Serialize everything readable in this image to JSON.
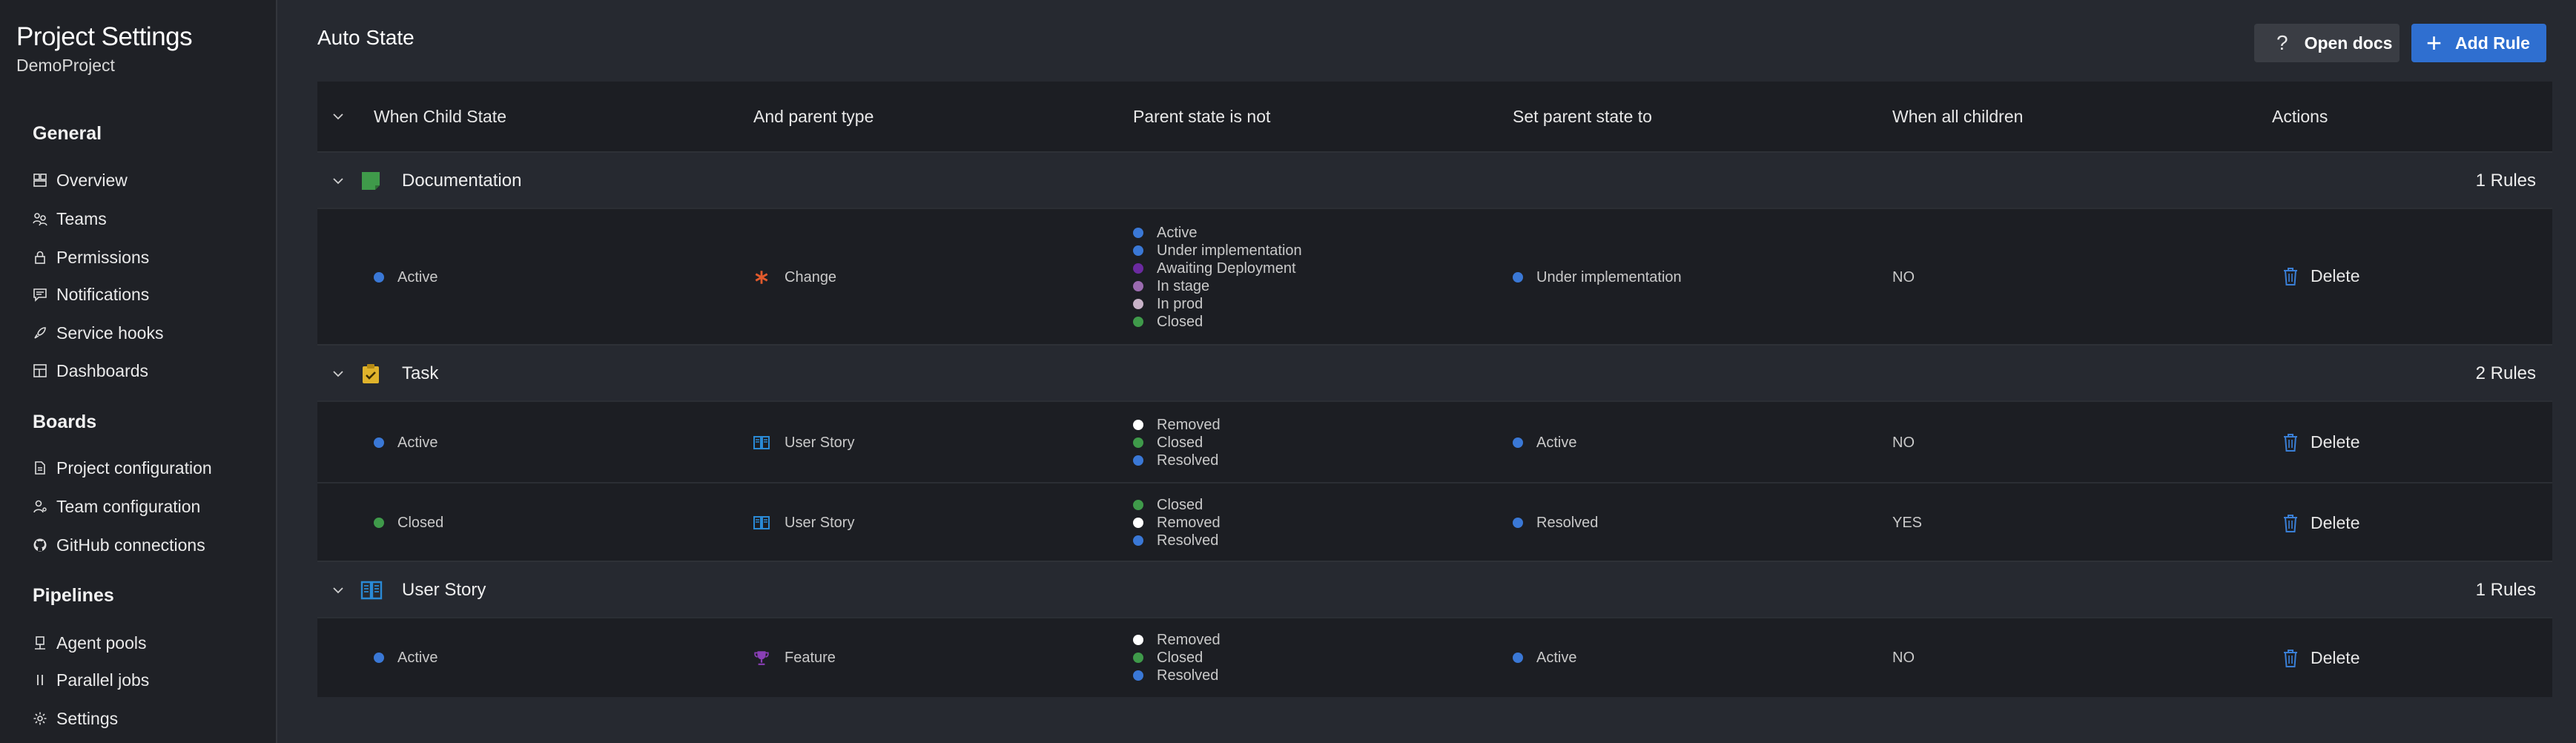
{
  "sidebar": {
    "title": "Project Settings",
    "project": "DemoProject",
    "sections": [
      {
        "label": "General",
        "items": [
          {
            "label": "Overview",
            "icon": "overview-icon"
          },
          {
            "label": "Teams",
            "icon": "teams-icon"
          },
          {
            "label": "Permissions",
            "icon": "lock-icon"
          },
          {
            "label": "Notifications",
            "icon": "chat-icon"
          },
          {
            "label": "Service hooks",
            "icon": "rocket-icon"
          },
          {
            "label": "Dashboards",
            "icon": "dashboard-icon"
          }
        ]
      },
      {
        "label": "Boards",
        "items": [
          {
            "label": "Project configuration",
            "icon": "doc-icon"
          },
          {
            "label": "Team configuration",
            "icon": "team-config-icon"
          },
          {
            "label": "GitHub connections",
            "icon": "github-icon"
          }
        ]
      },
      {
        "label": "Pipelines",
        "items": [
          {
            "label": "Agent pools",
            "icon": "agent-icon"
          },
          {
            "label": "Parallel jobs",
            "icon": "parallel-icon"
          },
          {
            "label": "Settings",
            "icon": "gear-icon"
          }
        ]
      }
    ]
  },
  "main": {
    "title": "Auto State",
    "open_docs": "Open docs",
    "add_rule": "Add Rule"
  },
  "table": {
    "headers": [
      "When Child State",
      "And parent type",
      "Parent state is not",
      "Set parent state to",
      "When all children",
      "Actions"
    ],
    "groups": [
      {
        "name": "Documentation",
        "count": "1 Rules",
        "icon": "documentation-icon",
        "icon_color": "#3f9a4a",
        "rules": [
          {
            "child_state": "Active",
            "child_color": "#3a78d6",
            "parent_type": "Change",
            "parent_icon": "asterisk-icon",
            "parent_icon_color": "#e25a2c",
            "not_states": [
              {
                "label": "Active",
                "color": "#3a78d6"
              },
              {
                "label": "Under implementation",
                "color": "#3a78d6"
              },
              {
                "label": "Awaiting Deployment",
                "color": "#6b2aa0"
              },
              {
                "label": "In stage",
                "color": "#9b6bb0"
              },
              {
                "label": "In prod",
                "color": "#c8b3c8"
              },
              {
                "label": "Closed",
                "color": "#3f9a4a"
              }
            ],
            "set_state": "Under implementation",
            "set_color": "#3a78d6",
            "all_children": "NO",
            "action": "Delete"
          }
        ]
      },
      {
        "name": "Task",
        "count": "2 Rules",
        "icon": "task-icon",
        "icon_color": "#e0b32b",
        "rules": [
          {
            "child_state": "Active",
            "child_color": "#3a78d6",
            "parent_type": "User Story",
            "parent_icon": "book-icon",
            "parent_icon_color": "#2a8ad6",
            "not_states": [
              {
                "label": "Removed",
                "color": "#ffffff"
              },
              {
                "label": "Closed",
                "color": "#3f9a4a"
              },
              {
                "label": "Resolved",
                "color": "#3a78d6"
              }
            ],
            "set_state": "Active",
            "set_color": "#3a78d6",
            "all_children": "NO",
            "action": "Delete"
          },
          {
            "child_state": "Closed",
            "child_color": "#3f9a4a",
            "parent_type": "User Story",
            "parent_icon": "book-icon",
            "parent_icon_color": "#2a8ad6",
            "not_states": [
              {
                "label": "Closed",
                "color": "#3f9a4a"
              },
              {
                "label": "Removed",
                "color": "#ffffff"
              },
              {
                "label": "Resolved",
                "color": "#3a78d6"
              }
            ],
            "set_state": "Resolved",
            "set_color": "#3a78d6",
            "all_children": "YES",
            "action": "Delete"
          }
        ]
      },
      {
        "name": "User Story",
        "count": "1 Rules",
        "icon": "book-icon",
        "icon_color": "#2a8ad6",
        "rules": [
          {
            "child_state": "Active",
            "child_color": "#3a78d6",
            "parent_type": "Feature",
            "parent_icon": "trophy-icon",
            "parent_icon_color": "#8a3fb6",
            "not_states": [
              {
                "label": "Removed",
                "color": "#ffffff"
              },
              {
                "label": "Closed",
                "color": "#3f9a4a"
              },
              {
                "label": "Resolved",
                "color": "#3a78d6"
              }
            ],
            "set_state": "Active",
            "set_color": "#3a78d6",
            "all_children": "NO",
            "action": "Delete"
          }
        ]
      }
    ]
  }
}
